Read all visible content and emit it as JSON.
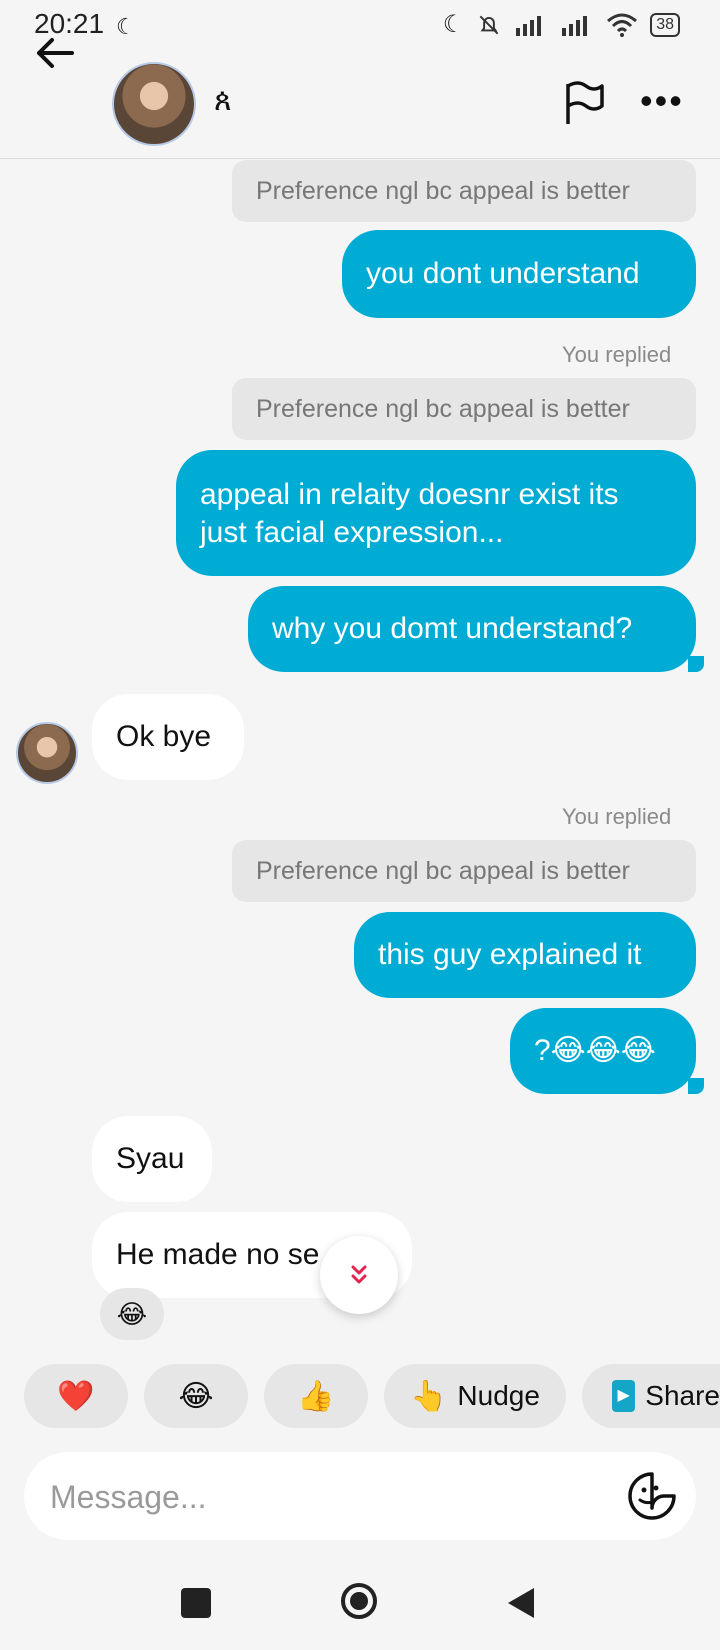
{
  "status_bar": {
    "time": "20:21",
    "battery": "38"
  },
  "header": {
    "contact_glyph": "ጰ",
    "icons": [
      "back-arrow-icon",
      "flag-icon",
      "more-options-icon"
    ]
  },
  "messages": [
    {
      "type": "reply_preview",
      "text": "Preference ngl bc appeal is better"
    },
    {
      "type": "outgoing",
      "text": "you dont understand"
    },
    {
      "type": "you_replied",
      "text": "You replied"
    },
    {
      "type": "reply_preview",
      "text": "Preference ngl bc appeal is better"
    },
    {
      "type": "outgoing",
      "text": "appeal in relaity doesnr exist its just facial expression..."
    },
    {
      "type": "outgoing",
      "text": "why you domt understand?"
    },
    {
      "type": "incoming",
      "text": "Ok bye"
    },
    {
      "type": "you_replied",
      "text": "You replied"
    },
    {
      "type": "reply_preview",
      "text": "Preference ngl bc appeal is better"
    },
    {
      "type": "outgoing",
      "text": "this guy explained it"
    },
    {
      "type": "outgoing",
      "text": "?😂😂😂"
    },
    {
      "type": "incoming",
      "text": "Syau"
    },
    {
      "type": "incoming",
      "text": "He made no se"
    },
    {
      "type": "reaction",
      "text": "😂"
    }
  ],
  "quick_reactions": [
    {
      "emoji": "❤️"
    },
    {
      "emoji": "😂"
    },
    {
      "emoji": "👍"
    },
    {
      "emoji": "👆",
      "label": "Nudge"
    },
    {
      "emoji": "▶",
      "label": "Share"
    }
  ],
  "composer": {
    "placeholder": "Message..."
  },
  "colors": {
    "outgoing_bubble": "#00acd4",
    "incoming_bubble": "#ffffff",
    "background": "#f5f5f5",
    "reply_pill": "#e6e6e6"
  }
}
